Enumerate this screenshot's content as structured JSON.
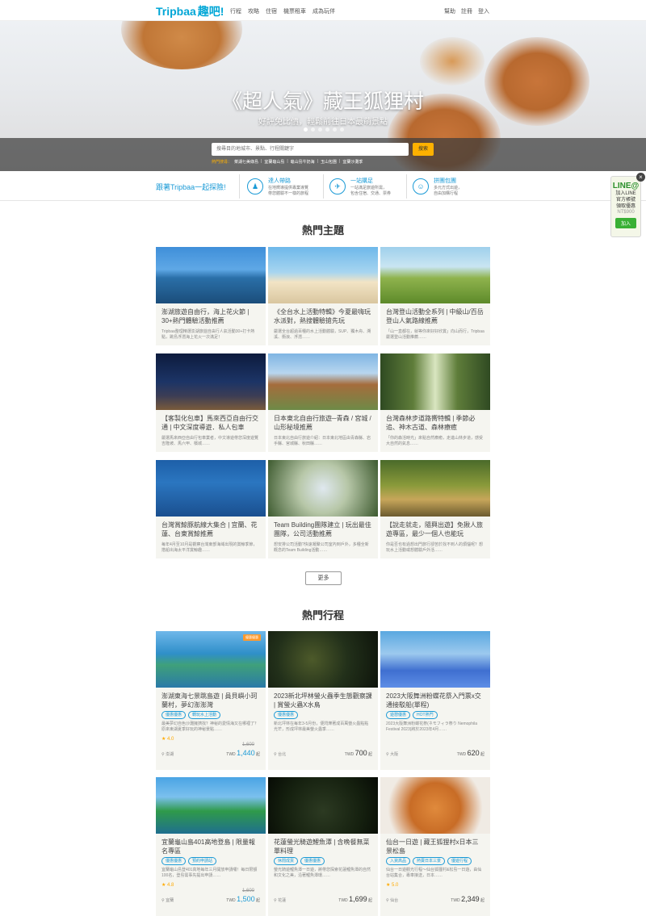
{
  "header": {
    "logo_en": "Tripbaa",
    "logo_zh": "趣吧!",
    "nav": [
      "行程",
      "攻略",
      "住宿",
      "機票租車",
      "成為玩伴"
    ],
    "right": [
      "幫助",
      "註冊",
      "登入"
    ]
  },
  "hero": {
    "title": "《超人氣》藏王狐狸村",
    "subtitle": "好評免比價，輕鬆前往日本最萌景點",
    "search_placeholder": "搜尋目的地城市、景點、行程關鍵字",
    "search_button": "搜索",
    "hot_label": "熱門搜尋：",
    "hot_items": [
      "菜湖七美綠島",
      "宜蘭龜山島",
      "龜山島牛奶海",
      "玉山包團",
      "宜蘭沙灘季"
    ]
  },
  "features": {
    "lead": "跟著Tripbaa一起探險!",
    "items": [
      {
        "title": "達人帶路",
        "desc1": "在地嚮導提供專業導覽",
        "desc2": "帶您體驗不一樣的旅程",
        "icon": "guide-icon"
      },
      {
        "title": "一站購足",
        "desc1": "一站滿足旅遊所需，",
        "desc2": "包含住宿、交通、票券",
        "icon": "compass-icon"
      },
      {
        "title": "拼團包團",
        "desc1": "多元方式出遊，",
        "desc2": "自由加購行程",
        "icon": "group-icon"
      }
    ]
  },
  "line_widget": {
    "title": "LINE@",
    "lines": [
      "加入LINE",
      "官方帳號",
      "領取優惠"
    ],
    "price": "NT$900",
    "button": "加入",
    "close": "×"
  },
  "popular_topics": {
    "heading": "熱門主題",
    "cards": [
      {
        "title": "澎湖旅遊自由行，海上花火節 | 30+熱門體驗活動推薦",
        "desc": "Tripbaa整理精選澎湖旅遊自由行人氣活動30+打卡熱點，跳島浮潛海上花火一次滿足！"
      },
      {
        "title": "《全台水上活動特輯》今夏最嗨玩水派對，熱搜體驗搶先玩",
        "desc": "嚴選全台超過百種的水上活動體驗，SUP、獨木舟、溯溪、衝浪、浮潛……"
      },
      {
        "title": "台灣登山活動全系列 | 中級山/百岳登山人氣路線推薦",
        "desc": "「山一直都在，就等你來好好欣賞」向山而行，Tripbaa嚴選登山活動推薦……"
      },
      {
        "title": "【客製化包車】馬來西亞自由行交通 | 中文深度導遊．私人包車",
        "desc": "嚴選馬來西亞自由行包車業者，中文導遊帶您深度遊覽吉隆坡、馬六甲、檳城……"
      },
      {
        "title": "日本東北自由行旅遊─青森 / 宮城 / 山形秘境推薦",
        "desc": "日本東北自由行旅遊介紹：日本東北地區由青森縣、岩手縣、宮城縣、秋田縣……"
      },
      {
        "title": "台灣森林步道路嚮特輯 | 季節必追、神木古道、森林療癒",
        "desc": "「你的森活時光」來點自然療癒，走進山林步道，感受大自然的氣息……"
      },
      {
        "title": "台灣賞鯨豚航線大集合 | 宜蘭、花蓮、台東賞鯨推薦",
        "desc": "每年4月至10月是觀察台灣東部海域出現的賞鯨季節，搭船出海太平洋賞鯨趣……"
      },
      {
        "title": "Team Building團隊建立 | 玩出最佳團隊，公司活動推薦",
        "desc": "想安排公司活動?快速凝聚公司室內到戶外，多種全新概念的Team Building活動……"
      },
      {
        "title": "【說走就走，隨興出遊】免揪人旅遊專區，最少一個人也能玩",
        "desc": "你是否也有過想出門旅行卻苦於找不到人的煩惱呢？想玩水上活動或想體驗戶外活……"
      }
    ],
    "more_button": "更多"
  },
  "popular_trips": {
    "heading": "熱門行程",
    "cards": [
      {
        "title": "澎湖東海七景跳島遊 | 員貝嶼小珂蘭村，夢幻澎澎灣",
        "tags": [
          "優惠優惠",
          "轉玩水上活動"
        ],
        "desc": "最美夢幻自色沙灘擁擠找？神秘的愛情海又在哪裡了？原來東湖夏季好玩的神秘景點……",
        "rating": "4.0",
        "old_price": "1,600",
        "location": "澎湖",
        "price": "1,440",
        "badge": "優惠優惠"
      },
      {
        "title": "2023新北坪林螢火蟲季生態觀察課 | 賞螢火蟲X水鳥",
        "tags": [
          "優惠優惠"
        ],
        "desc": "新北坪林在每年3-5月份，便閃爍著成百萬螢火蟲點點光芒，形成坪林最美螢火蟲季……",
        "rating": "",
        "old_price": "",
        "location": "台北",
        "price": "700",
        "badge": ""
      },
      {
        "title": "2023大阪舞洲粉蝶花祭入門票x交通接駁船(單程)",
        "tags": [
          "遊憩優惠",
          "HOT熱門"
        ],
        "desc": "2023大阪舞洲粉蝶花祭(ネモフィラ祭り Nemophila Festival 2023)將於2023年4月……",
        "rating": "",
        "old_price": "",
        "location": "大阪",
        "price": "620",
        "badge": ""
      },
      {
        "title": "宜蘭龜山島401高地登島 | 限量報名專區",
        "tags": [
          "優惠優惠",
          "預約申請站"
        ],
        "desc": "宜蘭龜山島登401高地每年三月開放申請囉！每日限額100名，登島需事先提出申請……",
        "rating": "4.8",
        "old_price": "1,600",
        "location": "宜蘭",
        "price": "1,500",
        "badge": ""
      },
      {
        "title": "花蓮螢光騎遊鯉魚潭 | 含晚餐無菜單料理",
        "tags": [
          "休閒成貨",
          "優惠優惠"
        ],
        "desc": "螢光騎遊鯉魚潭一日遊，將帶您探索花蓮鯉魚潭的自然和文化之美，沿著鯉魚潭環……",
        "rating": "",
        "old_price": "",
        "location": "花蓮",
        "price": "1,699",
        "badge": ""
      },
      {
        "title": "仙台一日遊 | 藏王狐狸村x日本三景松島",
        "tags": [
          "入資高品",
          "熱賣日本三景",
          "優遊行程"
        ],
        "desc": "仙台一日遊觀光行程～仙台狐狸村&松島一日遊，由仙台站集合，專車接送，日本……",
        "rating": "5.0",
        "old_price": "",
        "location": "仙台",
        "price": "2,349",
        "badge": ""
      }
    ],
    "currency": "TWD",
    "price_suffix": "起"
  }
}
